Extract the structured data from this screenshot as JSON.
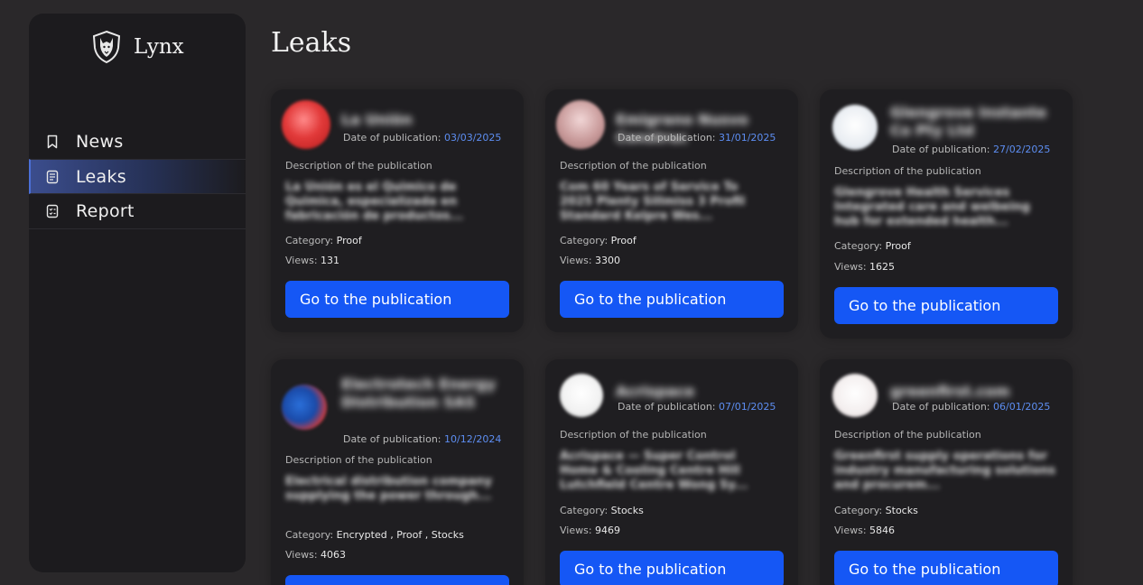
{
  "brand": {
    "name": "Lynx",
    "logo_icon": "wolf-shield-icon"
  },
  "nav": [
    {
      "label": "News",
      "icon": "bookmark-icon",
      "active": false
    },
    {
      "label": "Leaks",
      "icon": "document-icon",
      "active": true
    },
    {
      "label": "Report",
      "icon": "checklist-icon",
      "active": false
    }
  ],
  "page": {
    "title": "Leaks"
  },
  "labels": {
    "date_prefix": "Date of publication:",
    "description": "Description of the publication",
    "category_prefix": "Category:",
    "views_prefix": "Views:",
    "button": "Go to the publication"
  },
  "cards": [
    {
      "name": "La Uniön",
      "date": "03/03/2025",
      "description": "La Unión es el Quimico de Quimica, especializada en fabricación de productos...",
      "category": "Proof",
      "views": "131"
    },
    {
      "name": "Emigrano Nusvo Construc",
      "date": "31/01/2025",
      "description": "Com 60 Years of Service To 2025 Plenty Sillmiss 3 Profil Standard Kelpre Wes...",
      "category": "Proof",
      "views": "3300"
    },
    {
      "name": "Glengrove Instante Co Pty Ltd",
      "date": "27/02/2025",
      "description": "Glengrove Health Services Integrated care and welbeing hub for extended health...",
      "category": "Proof",
      "views": "1625"
    },
    {
      "name": "Electrotech Energy Distribution SAS",
      "date": "10/12/2024",
      "description": "Electrical distribution company supplying the power through...",
      "category": "Encrypted , Proof , Stocks",
      "views": "4063"
    },
    {
      "name": "Acrispace",
      "date": "07/01/2025",
      "description": "Acrispace — Super Control Home & Cooling Centre Hill Lutchfield Centre Wong Sy...",
      "category": "Stocks",
      "views": "9469"
    },
    {
      "name": "greenfirst.com",
      "date": "06/01/2025",
      "description": "Greenfirst supply operations for industry manufacturing solutions and procurem...",
      "category": "Stocks",
      "views": "5846"
    }
  ],
  "colors": {
    "accent": "#1557f5",
    "date": "#5d8ef2",
    "background": "#2a282a",
    "panel": "#1c1b1e",
    "card": "#1f1e21"
  }
}
